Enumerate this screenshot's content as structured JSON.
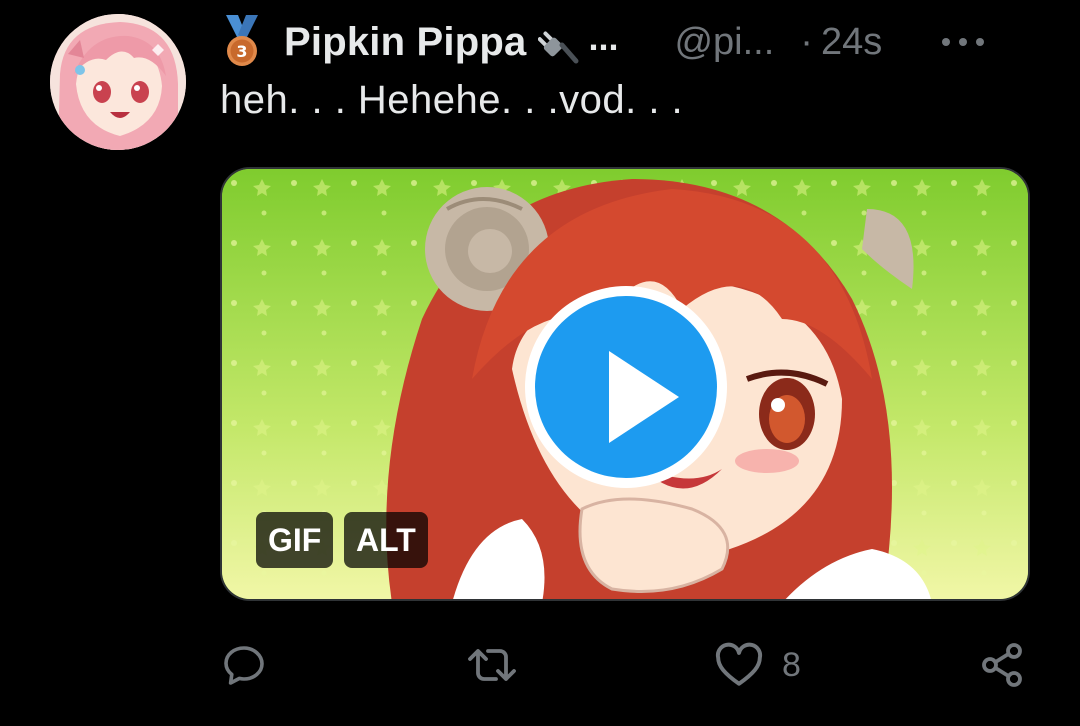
{
  "post": {
    "author": {
      "display_name": "Pipkin Pippa",
      "name_overflow": "...",
      "handle": "@pi...",
      "badge_icon": "third-place-medal-icon",
      "emoji_icon": "electric-plug-icon",
      "avatar": "pink-haired-anime-girl-avatar"
    },
    "separator": "·",
    "timestamp": "24s",
    "more_icon": "more-horizontal-icon",
    "text": "heh. . . Hehehe. . .vod. . .",
    "media": {
      "type": "gif",
      "gif_label": "GIF",
      "alt_label": "ALT",
      "play_icon": "play-icon",
      "play_color": "#1d9bf0",
      "description_icon": "anime-girl-with-ram-horns-gif"
    },
    "actions": {
      "reply_icon": "reply-icon",
      "repost_icon": "repost-icon",
      "like_icon": "heart-icon",
      "like_count": "8",
      "share_icon": "share-icon"
    }
  },
  "colors": {
    "background": "#000000",
    "primary_text": "#e7e9ea",
    "secondary_text": "#71767b",
    "accent": "#1d9bf0"
  }
}
